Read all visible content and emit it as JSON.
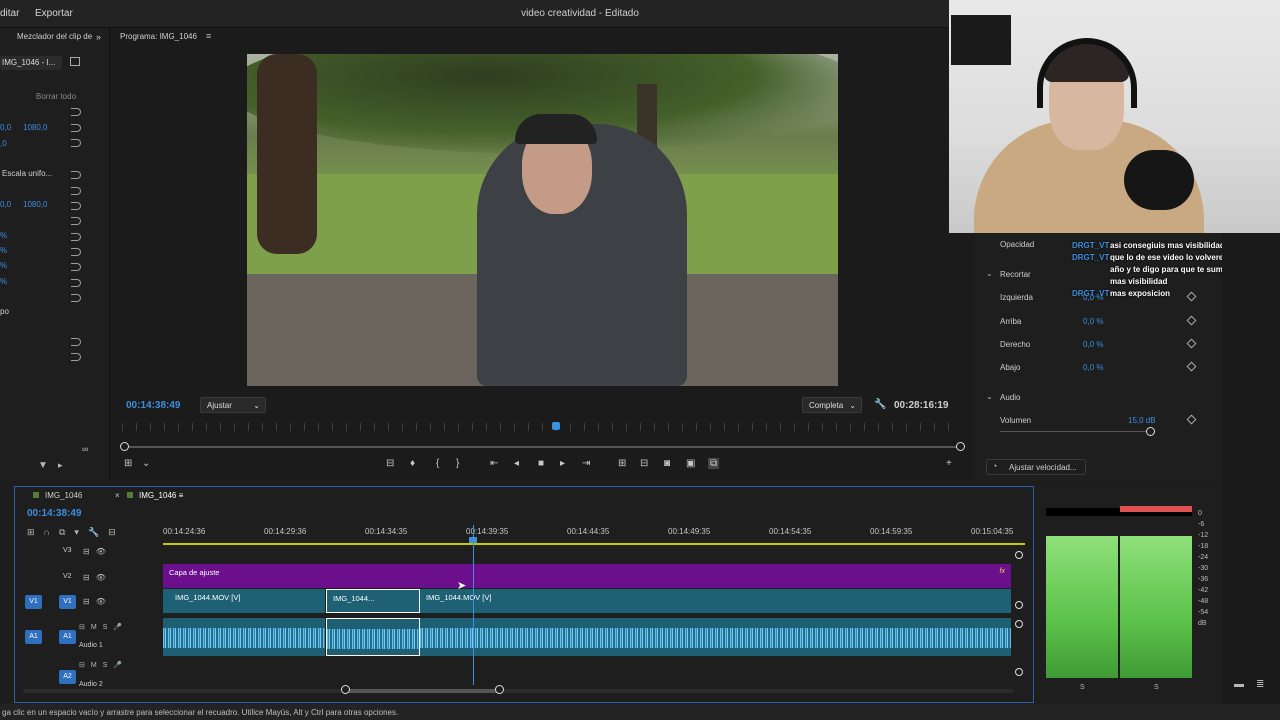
{
  "menu": {
    "edit": "ditar",
    "export": "Exportar",
    "title": "video creatividad - Editado"
  },
  "left_panel": {
    "tab": "Mezclador del clip de",
    "clip": "IMG_1046 - I...",
    "clear_all": "Borrar todo",
    "rows": [
      {
        "a": "0,0",
        "b": "1080,0"
      },
      {
        "a": ",0",
        "b": ""
      },
      {
        "a": "Escala unifo...",
        "b": ""
      },
      {
        "a": "0,0",
        "b": "1080,0"
      },
      {
        "a": "%",
        "b": ""
      },
      {
        "a": "%",
        "b": ""
      },
      {
        "a": "%",
        "b": ""
      },
      {
        "a": "%",
        "b": ""
      },
      {
        "a": "po",
        "b": ""
      }
    ]
  },
  "program": {
    "title": "Programa: IMG_1046",
    "timecode_current": "00:14:38:49",
    "fit": "Ajustar",
    "quality": "Completa",
    "timecode_total": "00:28:16:19"
  },
  "effects": {
    "opacity_label": "Opacidad",
    "crop_section": "Recortar",
    "left": "Izquierda",
    "top": "Arriba",
    "right": "Derecho",
    "bottom": "Abajo",
    "crop_value": "0,0 %",
    "audio_section": "Audio",
    "volume": "Volumen",
    "volume_value": "15,0 dB",
    "speed_button": "Ajustar velocidad..."
  },
  "overlay_text": {
    "tag": "DRGT_VT",
    "lines": [
      "asi consegiuis mas visibilidad",
      "que lo de ese video lo volvere a hacer este",
      "año y te digo para que te sumes y consigas",
      "mas visibilidad",
      "mas exposicion"
    ]
  },
  "timeline": {
    "tabs": [
      "IMG_1046",
      "IMG_1046"
    ],
    "timecode": "00:14:38:49",
    "ruler": [
      "00:14:24:36",
      "00:14:29:36",
      "00:14:34:35",
      "00:14:39:35",
      "00:14:44:35",
      "00:14:49:35",
      "00:14:54:35",
      "00:14:59:35",
      "00:15:04:35"
    ],
    "tracks": {
      "v3": "V3",
      "v2": "V2",
      "v1": "V1",
      "a1": "A1",
      "a2": "A2",
      "audio1": "Audio 1",
      "audio2": "Audio 2"
    },
    "clips": {
      "adjust": "Capa de ajuste",
      "v1_a": "IMG_1044.MOV [V]",
      "v1_b": "IMG_1044...",
      "v1_c": "IMG_1044.MOV [V]"
    }
  },
  "meter": {
    "scale": [
      "0",
      "-6",
      "-12",
      "-18",
      "-24",
      "-30",
      "-36",
      "-42",
      "-48",
      "-54",
      "dB"
    ],
    "solo": [
      "S",
      "S"
    ]
  },
  "status": "ga clic en un espacio vacío y arrastre para seleccionar el recuadro. Utilice Mayús, Alt y Ctrl para otras opciones."
}
